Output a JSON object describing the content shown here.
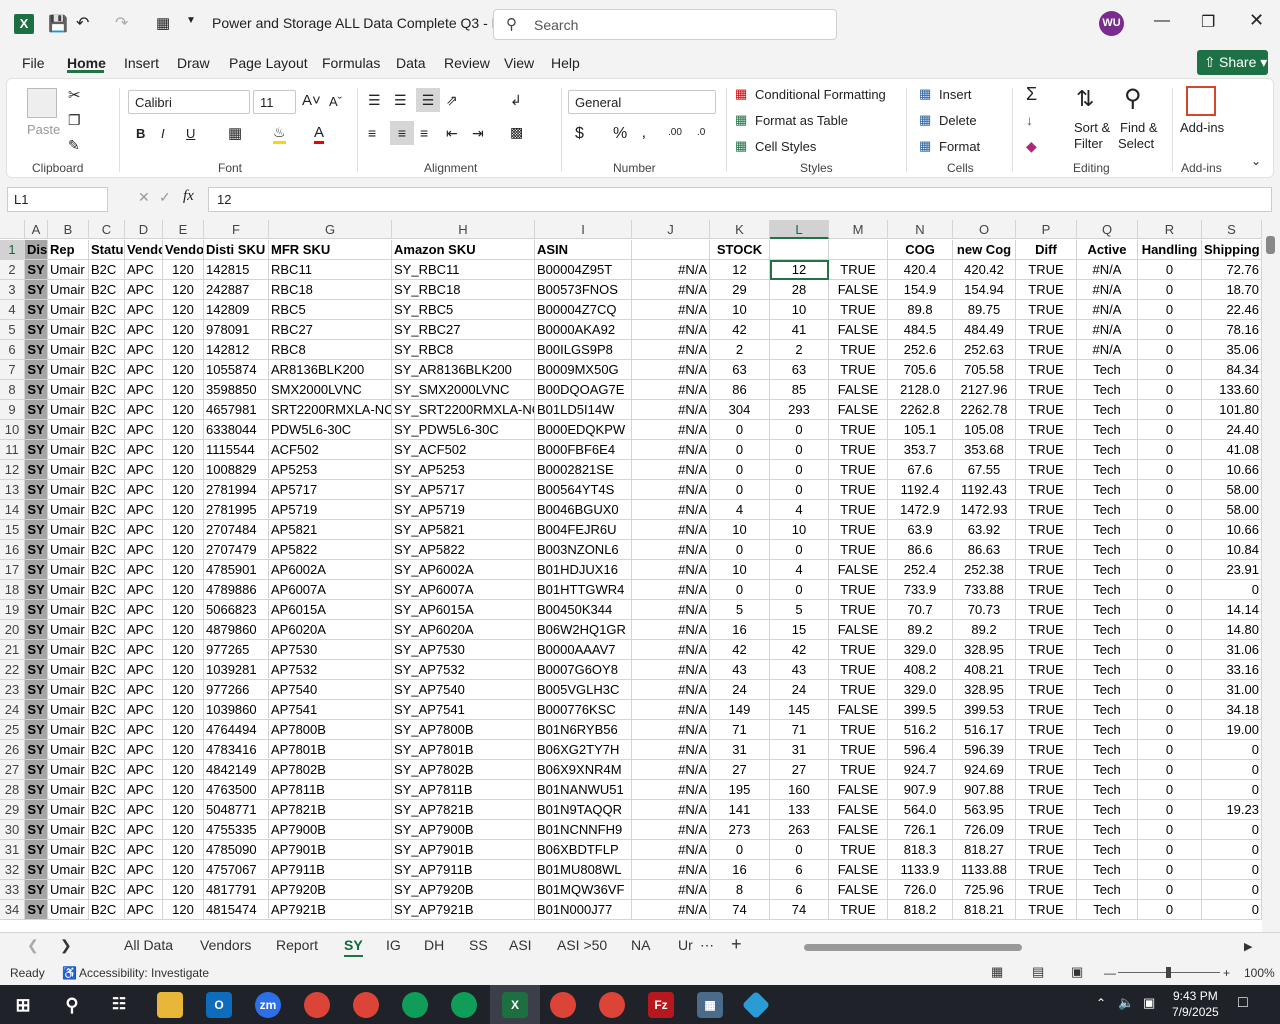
{
  "window": {
    "title": "Power and Storage ALL Data Complete Q3 - E...",
    "search_placeholder": "Search",
    "user_initials": "WU"
  },
  "menu": {
    "items": [
      "File",
      "Home",
      "Insert",
      "Draw",
      "Page Layout",
      "Formulas",
      "Data",
      "Review",
      "View",
      "Help"
    ],
    "share": "Share"
  },
  "ribbon": {
    "paste": "Paste",
    "font_name": "Calibri",
    "font_size": "11",
    "number_format": "General",
    "conditional_formatting": "Conditional Formatting",
    "format_as_table": "Format as Table",
    "cell_styles": "Cell Styles",
    "insert": "Insert",
    "delete": "Delete",
    "format": "Format",
    "sort_filter": "Sort &",
    "sort_filter2": "Filter",
    "find_select": "Find &",
    "find_select2": "Select",
    "addins": "Add-ins",
    "groups": {
      "clipboard": "Clipboard",
      "font": "Font",
      "alignment": "Alignment",
      "number": "Number",
      "styles": "Styles",
      "cells": "Cells",
      "editing": "Editing",
      "addins": "Add-ins"
    }
  },
  "formula_bar": {
    "name_box": "L1",
    "formula": "12"
  },
  "columns": [
    "A",
    "B",
    "C",
    "D",
    "E",
    "F",
    "G",
    "H",
    "I",
    "J",
    "K",
    "L",
    "M",
    "N",
    "O",
    "P",
    "Q",
    "R",
    "S"
  ],
  "header_row": [
    "Dis",
    "Rep",
    "Statu",
    "Vendo",
    "Vendo",
    "Disti SKU",
    "MFR SKU",
    "Amazon SKU",
    "ASIN",
    "",
    "STOCK",
    "",
    "",
    "COG",
    "new Cog",
    "Diff",
    "Active",
    "Handling",
    "Shipping"
  ],
  "rows": [
    [
      "SY",
      "Umair",
      "B2C",
      "APC",
      "120",
      "142815",
      "RBC11",
      "SY_RBC11",
      "B00004Z95T",
      "#N/A",
      "12",
      "12",
      "TRUE",
      "420.4",
      "420.42",
      "TRUE",
      "#N/A",
      "0",
      "72.76"
    ],
    [
      "SY",
      "Umair",
      "B2C",
      "APC",
      "120",
      "242887",
      "RBC18",
      "SY_RBC18",
      "B00573FNOS",
      "#N/A",
      "29",
      "28",
      "FALSE",
      "154.9",
      "154.94",
      "TRUE",
      "#N/A",
      "0",
      "18.70"
    ],
    [
      "SY",
      "Umair",
      "B2C",
      "APC",
      "120",
      "142809",
      "RBC5",
      "SY_RBC5",
      "B00004Z7CQ",
      "#N/A",
      "10",
      "10",
      "TRUE",
      "89.8",
      "89.75",
      "TRUE",
      "#N/A",
      "0",
      "22.46"
    ],
    [
      "SY",
      "Umair",
      "B2C",
      "APC",
      "120",
      "978091",
      "RBC27",
      "SY_RBC27",
      "B0000AKA92",
      "#N/A",
      "42",
      "41",
      "FALSE",
      "484.5",
      "484.49",
      "TRUE",
      "#N/A",
      "0",
      "78.16"
    ],
    [
      "SY",
      "Umair",
      "B2C",
      "APC",
      "120",
      "142812",
      "RBC8",
      "SY_RBC8",
      "B00ILGS9P8",
      "#N/A",
      "2",
      "2",
      "TRUE",
      "252.6",
      "252.63",
      "TRUE",
      "#N/A",
      "0",
      "35.06"
    ],
    [
      "SY",
      "Umair",
      "B2C",
      "APC",
      "120",
      "1055874",
      "AR8136BLK200",
      "SY_AR8136BLK200",
      "B0009MX50G",
      "#N/A",
      "63",
      "63",
      "TRUE",
      "705.6",
      "705.58",
      "TRUE",
      "Tech",
      "0",
      "84.34"
    ],
    [
      "SY",
      "Umair",
      "B2C",
      "APC",
      "120",
      "3598850",
      "SMX2000LVNC",
      "SY_SMX2000LVNC",
      "B00DQOAG7E",
      "#N/A",
      "86",
      "85",
      "FALSE",
      "2128.0",
      "2127.96",
      "TRUE",
      "Tech",
      "0",
      "133.60"
    ],
    [
      "SY",
      "Umair",
      "B2C",
      "APC",
      "120",
      "4657981",
      "SRT2200RMXLA-NC",
      "SY_SRT2200RMXLA-NC",
      "B01LD5I14W",
      "#N/A",
      "304",
      "293",
      "FALSE",
      "2262.8",
      "2262.78",
      "TRUE",
      "Tech",
      "0",
      "101.80"
    ],
    [
      "SY",
      "Umair",
      "B2C",
      "APC",
      "120",
      "6338044",
      "PDW5L6-30C",
      "SY_PDW5L6-30C",
      "B000EDQKPW",
      "#N/A",
      "0",
      "0",
      "TRUE",
      "105.1",
      "105.08",
      "TRUE",
      "Tech",
      "0",
      "24.40"
    ],
    [
      "SY",
      "Umair",
      "B2C",
      "APC",
      "120",
      "1115544",
      "ACF502",
      "SY_ACF502",
      "B000FBF6E4",
      "#N/A",
      "0",
      "0",
      "TRUE",
      "353.7",
      "353.68",
      "TRUE",
      "Tech",
      "0",
      "41.08"
    ],
    [
      "SY",
      "Umair",
      "B2C",
      "APC",
      "120",
      "1008829",
      "AP5253",
      "SY_AP5253",
      "B0002821SE",
      "#N/A",
      "0",
      "0",
      "TRUE",
      "67.6",
      "67.55",
      "TRUE",
      "Tech",
      "0",
      "10.66"
    ],
    [
      "SY",
      "Umair",
      "B2C",
      "APC",
      "120",
      "2781994",
      "AP5717",
      "SY_AP5717",
      "B00564YT4S",
      "#N/A",
      "0",
      "0",
      "TRUE",
      "1192.4",
      "1192.43",
      "TRUE",
      "Tech",
      "0",
      "58.00"
    ],
    [
      "SY",
      "Umair",
      "B2C",
      "APC",
      "120",
      "2781995",
      "AP5719",
      "SY_AP5719",
      "B0046BGUX0",
      "#N/A",
      "4",
      "4",
      "TRUE",
      "1472.9",
      "1472.93",
      "TRUE",
      "Tech",
      "0",
      "58.00"
    ],
    [
      "SY",
      "Umair",
      "B2C",
      "APC",
      "120",
      "2707484",
      "AP5821",
      "SY_AP5821",
      "B004FEJR6U",
      "#N/A",
      "10",
      "10",
      "TRUE",
      "63.9",
      "63.92",
      "TRUE",
      "Tech",
      "0",
      "10.66"
    ],
    [
      "SY",
      "Umair",
      "B2C",
      "APC",
      "120",
      "2707479",
      "AP5822",
      "SY_AP5822",
      "B003NZONL6",
      "#N/A",
      "0",
      "0",
      "TRUE",
      "86.6",
      "86.63",
      "TRUE",
      "Tech",
      "0",
      "10.84"
    ],
    [
      "SY",
      "Umair",
      "B2C",
      "APC",
      "120",
      "4785901",
      "AP6002A",
      "SY_AP6002A",
      "B01HDJUX16",
      "#N/A",
      "10",
      "4",
      "FALSE",
      "252.4",
      "252.38",
      "TRUE",
      "Tech",
      "0",
      "23.91"
    ],
    [
      "SY",
      "Umair",
      "B2C",
      "APC",
      "120",
      "4789886",
      "AP6007A",
      "SY_AP6007A",
      "B01HTTGWR4",
      "#N/A",
      "0",
      "0",
      "TRUE",
      "733.9",
      "733.88",
      "TRUE",
      "Tech",
      "0",
      "0"
    ],
    [
      "SY",
      "Umair",
      "B2C",
      "APC",
      "120",
      "5066823",
      "AP6015A",
      "SY_AP6015A",
      "B00450K344",
      "#N/A",
      "5",
      "5",
      "TRUE",
      "70.7",
      "70.73",
      "TRUE",
      "Tech",
      "0",
      "14.14"
    ],
    [
      "SY",
      "Umair",
      "B2C",
      "APC",
      "120",
      "4879860",
      "AP6020A",
      "SY_AP6020A",
      "B06W2HQ1GR",
      "#N/A",
      "16",
      "15",
      "FALSE",
      "89.2",
      "89.2",
      "TRUE",
      "Tech",
      "0",
      "14.80"
    ],
    [
      "SY",
      "Umair",
      "B2C",
      "APC",
      "120",
      "977265",
      "AP7530",
      "SY_AP7530",
      "B0000AAAV7",
      "#N/A",
      "42",
      "42",
      "TRUE",
      "329.0",
      "328.95",
      "TRUE",
      "Tech",
      "0",
      "31.06"
    ],
    [
      "SY",
      "Umair",
      "B2C",
      "APC",
      "120",
      "1039281",
      "AP7532",
      "SY_AP7532",
      "B0007G6OY8",
      "#N/A",
      "43",
      "43",
      "TRUE",
      "408.2",
      "408.21",
      "TRUE",
      "Tech",
      "0",
      "33.16"
    ],
    [
      "SY",
      "Umair",
      "B2C",
      "APC",
      "120",
      "977266",
      "AP7540",
      "SY_AP7540",
      "B005VGLH3C",
      "#N/A",
      "24",
      "24",
      "TRUE",
      "329.0",
      "328.95",
      "TRUE",
      "Tech",
      "0",
      "31.00"
    ],
    [
      "SY",
      "Umair",
      "B2C",
      "APC",
      "120",
      "1039860",
      "AP7541",
      "SY_AP7541",
      "B000776KSC",
      "#N/A",
      "149",
      "145",
      "FALSE",
      "399.5",
      "399.53",
      "TRUE",
      "Tech",
      "0",
      "34.18"
    ],
    [
      "SY",
      "Umair",
      "B2C",
      "APC",
      "120",
      "4764494",
      "AP7800B",
      "SY_AP7800B",
      "B01N6RYB56",
      "#N/A",
      "71",
      "71",
      "TRUE",
      "516.2",
      "516.17",
      "TRUE",
      "Tech",
      "0",
      "19.00"
    ],
    [
      "SY",
      "Umair",
      "B2C",
      "APC",
      "120",
      "4783416",
      "AP7801B",
      "SY_AP7801B",
      "B06XG2TY7H",
      "#N/A",
      "31",
      "31",
      "TRUE",
      "596.4",
      "596.39",
      "TRUE",
      "Tech",
      "0",
      "0"
    ],
    [
      "SY",
      "Umair",
      "B2C",
      "APC",
      "120",
      "4842149",
      "AP7802B",
      "SY_AP7802B",
      "B06X9XNR4M",
      "#N/A",
      "27",
      "27",
      "TRUE",
      "924.7",
      "924.69",
      "TRUE",
      "Tech",
      "0",
      "0"
    ],
    [
      "SY",
      "Umair",
      "B2C",
      "APC",
      "120",
      "4763500",
      "AP7811B",
      "SY_AP7811B",
      "B01NANWU51",
      "#N/A",
      "195",
      "160",
      "FALSE",
      "907.9",
      "907.88",
      "TRUE",
      "Tech",
      "0",
      "0"
    ],
    [
      "SY",
      "Umair",
      "B2C",
      "APC",
      "120",
      "5048771",
      "AP7821B",
      "SY_AP7821B",
      "B01N9TAQQR",
      "#N/A",
      "141",
      "133",
      "FALSE",
      "564.0",
      "563.95",
      "TRUE",
      "Tech",
      "0",
      "19.23"
    ],
    [
      "SY",
      "Umair",
      "B2C",
      "APC",
      "120",
      "4755335",
      "AP7900B",
      "SY_AP7900B",
      "B01NCNNFH9",
      "#N/A",
      "273",
      "263",
      "FALSE",
      "726.1",
      "726.09",
      "TRUE",
      "Tech",
      "0",
      "0"
    ],
    [
      "SY",
      "Umair",
      "B2C",
      "APC",
      "120",
      "4785090",
      "AP7901B",
      "SY_AP7901B",
      "B06XBDTFLP",
      "#N/A",
      "0",
      "0",
      "TRUE",
      "818.3",
      "818.27",
      "TRUE",
      "Tech",
      "0",
      "0"
    ],
    [
      "SY",
      "Umair",
      "B2C",
      "APC",
      "120",
      "4757067",
      "AP7911B",
      "SY_AP7911B",
      "B01MU808WL",
      "#N/A",
      "16",
      "6",
      "FALSE",
      "1133.9",
      "1133.88",
      "TRUE",
      "Tech",
      "0",
      "0"
    ],
    [
      "SY",
      "Umair",
      "B2C",
      "APC",
      "120",
      "4817791",
      "AP7920B",
      "SY_AP7920B",
      "B01MQW36VF",
      "#N/A",
      "8",
      "6",
      "FALSE",
      "726.0",
      "725.96",
      "TRUE",
      "Tech",
      "0",
      "0"
    ],
    [
      "SY",
      "Umair",
      "B2C",
      "APC",
      "120",
      "4815474",
      "AP7921B",
      "SY_AP7921B",
      "B01N000J77",
      "#N/A",
      "74",
      "74",
      "TRUE",
      "818.2",
      "818.21",
      "TRUE",
      "Tech",
      "0",
      "0"
    ]
  ],
  "sheet_tabs": [
    "All Data",
    "Vendors",
    "Report",
    "SY",
    "IG",
    "DH",
    "SS",
    "ASI",
    "ASI >50",
    "NA",
    "Ur"
  ],
  "active_tab": "SY",
  "status": {
    "ready": "Ready",
    "accessibility": "Accessibility: Investigate",
    "zoom": "100%"
  },
  "taskbar": {
    "time": "9:43 PM",
    "date": "7/9/2025"
  }
}
